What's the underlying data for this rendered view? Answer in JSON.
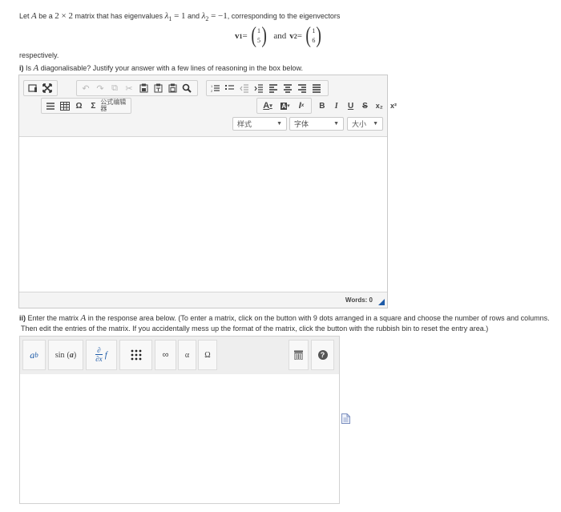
{
  "intro": {
    "p1": "Let ",
    "A": "A",
    "p2": " be a ",
    "dims": "2 × 2",
    "p3": " matrix that has eigenvalues ",
    "lambda1": "λ",
    "sub1": "1",
    "eq1": " = 1",
    "and": " and ",
    "lambda2": "λ",
    "sub2": "2",
    "eq2": " = −1",
    "p4": ", corresponding to the eigenvectors"
  },
  "vectors": {
    "v1_label": "v",
    "v1_sub": "1",
    "eq": " = ",
    "v1_top": "1",
    "v1_bottom": "5",
    "and": "and",
    "v2_label": "v",
    "v2_sub": "2",
    "v2_top": "1",
    "v2_bottom": "6"
  },
  "respectively": "respectively.",
  "question1": {
    "label": "i)",
    "text_before": " Is ",
    "A": "A",
    "text_after": " diagonalisable? Justify your answer with a few lines of reasoning in the box below."
  },
  "editor1": {
    "toolbar_icons": [
      "source-icon",
      "maximize-icon",
      "undo-icon",
      "redo-icon",
      "copy-icon",
      "cut-icon",
      "paste-icon",
      "paste-text-icon",
      "paste-word-icon",
      "find-icon",
      "numbered-list-icon",
      "bulleted-list-icon",
      "outdent-icon",
      "indent-icon",
      "align-left-icon",
      "align-center-icon",
      "align-right-icon",
      "justify-icon",
      "horizontal-line-icon",
      "table-icon",
      "special-char-icon",
      "formula-icon"
    ],
    "formula_label": "公式编辑器",
    "font_color_label": "A",
    "bg_color_label": "A",
    "bold_label": "B",
    "italic_label": "I",
    "underline_label": "U",
    "strike_label": "S",
    "sub_label": "x₂",
    "sup_label": "x²",
    "styles_label": "样式",
    "font_label": "字体",
    "size_label": "大小",
    "words_label": "Words: 0"
  },
  "question2": {
    "label": "ii)",
    "text1": " Enter the matrix ",
    "A": "A",
    "text2": " in the response area below. (To enter a matrix, click on the button with 9 dots arranged in a square and choose the number of rows and columns.",
    "line2": "Then edit the entries of the matrix. If you accidentally mess up the format of the matrix, click the button with the rubbish bin to reset the entry area.)"
  },
  "editor2": {
    "power_base": "a",
    "power_exp": "b",
    "sin_label": "sin",
    "sin_arg": "a",
    "partial_top": "∂",
    "partial_bottom": "∂x",
    "partial_f": "f",
    "infinity": "∞",
    "alpha": "α",
    "omega": "Ω",
    "help": "?"
  },
  "colors": {
    "accent": "#1e5ba8",
    "help_bg": "#555555",
    "toolbar_bg": "#f4f4f4"
  }
}
